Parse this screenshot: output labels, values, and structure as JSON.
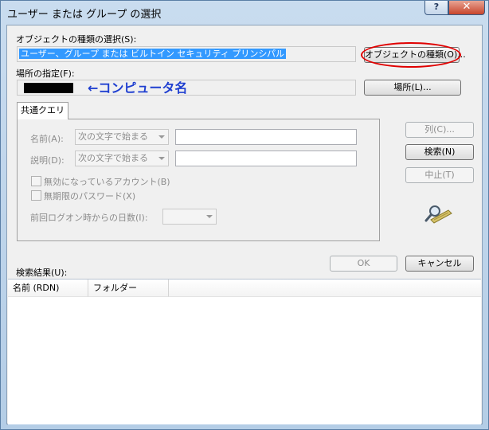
{
  "window": {
    "title": "ユーザー または グループ の選択",
    "help_label": "?",
    "close_label": "✕"
  },
  "object_types": {
    "label": "オブジェクトの種類の選択(S):",
    "value": "ユーザー、グループ または ビルトイン セキュリティ プリンシパル",
    "button_label": "オブジェクトの種類(O)..."
  },
  "location": {
    "label": "場所の指定(F):",
    "annotation": "←コンピュータ名",
    "button_label": "場所(L)..."
  },
  "common_queries": {
    "tab_label": "共通クエリ",
    "name_label": "名前(A):",
    "name_mode": "次の文字で始まる",
    "description_label": "説明(D):",
    "description_mode": "次の文字で始まる",
    "disabled_accounts_label": "無効になっているアカウント(B)",
    "non_expiring_password_label": "無期限のパスワード(X)",
    "days_since_logon_label": "前回ログオン時からの日数(I):"
  },
  "side_buttons": {
    "columns_label": "列(C)...",
    "search_label": "検索(N)",
    "stop_label": "中止(T)"
  },
  "dialog_buttons": {
    "ok_label": "OK",
    "cancel_label": "キャンセル"
  },
  "results": {
    "label": "検索結果(U):",
    "columns": [
      "名前 (RDN)",
      "フォルダー"
    ]
  },
  "colors": {
    "annotation_text": "#1f3fd0",
    "highlight_ellipse": "#e00000",
    "selection": "#3399ff"
  },
  "icons": [
    "magnifier-search-icon"
  ]
}
